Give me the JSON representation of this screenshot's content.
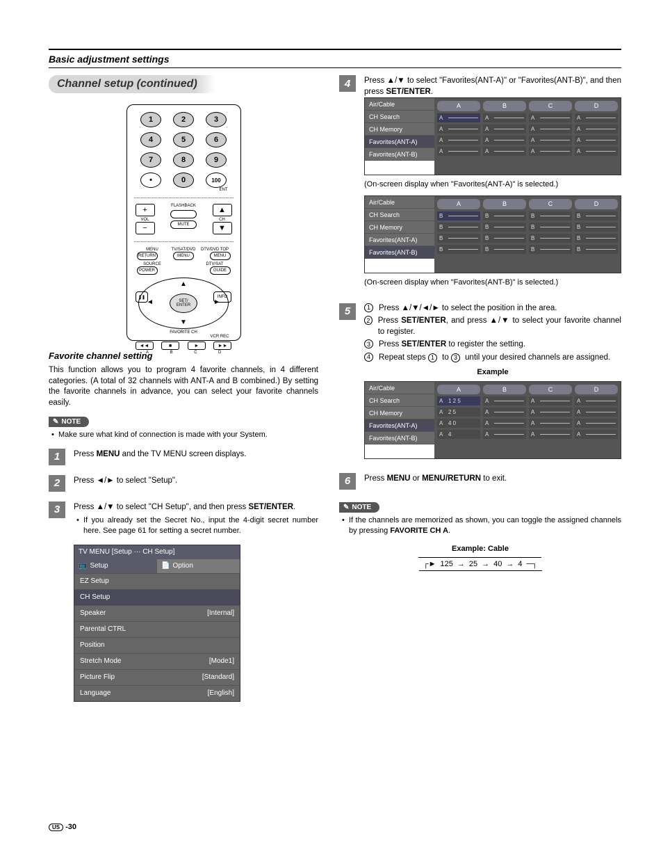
{
  "header": {
    "title": "Basic adjustment settings"
  },
  "section_title": "Channel setup (continued)",
  "remote": {
    "num": [
      "1",
      "2",
      "3",
      "4",
      "5",
      "6",
      "7",
      "8",
      "9",
      "•",
      "0",
      "100"
    ],
    "ent": "ENT",
    "flashback": "FLASHBACK",
    "vol": "VOL",
    "ch": "CH",
    "mute": "MUTE",
    "row_labels": [
      "MENU",
      "TV/SAT/DVD",
      "DTV/DVD TOP"
    ],
    "row_btns": [
      "RETURN",
      "MENU",
      "MENU"
    ],
    "row2_labels": [
      "SOURCE",
      "",
      "DTV/SAT"
    ],
    "row2_btns": [
      "POWER",
      "",
      "GUIDE"
    ],
    "setenter": "SET/\nENTER",
    "info": "INFO",
    "favorite": "FAVORITE CH",
    "vcr": "VCR REC",
    "media_labels": [
      "A",
      "B",
      "C",
      "D"
    ]
  },
  "favorite": {
    "heading": "Favorite channel setting",
    "body": "This function allows you to program 4 favorite channels, in 4 different categories. (A total of 32 channels with ANT-A and B combined.) By setting the favorite channels in advance, you can select your favorite channels easily.",
    "note_label": "NOTE",
    "note_bullet": "Make sure what kind of connection is made with your System."
  },
  "steps": {
    "s1": {
      "num": "1",
      "text_a": "Press ",
      "menu": "MENU",
      "text_b": " and the TV MENU screen displays."
    },
    "s2": {
      "num": "2",
      "text_a": "Press ",
      "arrows": "◄/►",
      "text_b": " to select \"Setup\"."
    },
    "s3": {
      "num": "3",
      "text_a": "Press ",
      "arrows": "▲/▼",
      "text_b": " to select \"CH Setup\", and then press ",
      "setenter": "SET/ENTER",
      "bullet": "If you already set the Secret No., input the 4-digit secret number here. See page 61 for setting a secret number."
    },
    "s4": {
      "num": "4",
      "text_a": "Press ",
      "arrows": "▲/▼",
      "text_b": " to select \"Favorites(ANT-A)\" or \"Favorites(ANT-B)\", and then press ",
      "setenter": "SET/ENTER"
    },
    "s5": {
      "num": "5",
      "sub1a": "Press ",
      "sub1_arrows": "▲/▼/◄/►",
      "sub1b": " to select the position in the area.",
      "sub2a": "Press ",
      "sub2_se": "SET/ENTER",
      "sub2b": ", and press ",
      "sub2_arrows": "▲/▼",
      "sub2c": " to select your favorite channel to register.",
      "sub3a": "Press ",
      "sub3_se": "SET/ENTER",
      "sub3b": " to register the setting.",
      "sub4a": "Repeat steps ",
      "sub4_1": "1",
      "sub4_to": " to ",
      "sub4_3": "3",
      "sub4b": " until your desired channels are assigned."
    },
    "s6": {
      "num": "6",
      "text_a": "Press ",
      "menu": "MENU",
      "or": " or ",
      "mr": "MENU/RETURN",
      "text_b": " to exit."
    }
  },
  "osd": {
    "breadcrumb": "TV MENU    [Setup ··· CH Setup]",
    "tab1": "Setup",
    "tab2": "Option",
    "rows": [
      {
        "l": "EZ Setup",
        "r": ""
      },
      {
        "l": "CH Setup",
        "r": ""
      },
      {
        "l": "Speaker",
        "r": "[Internal]"
      },
      {
        "l": "Parental CTRL",
        "r": ""
      },
      {
        "l": "Position",
        "r": ""
      },
      {
        "l": "Stretch Mode",
        "r": "[Mode1]"
      },
      {
        "l": "Picture Flip",
        "r": "[Standard]"
      },
      {
        "l": "Language",
        "r": "[English]"
      }
    ]
  },
  "fav_menu": {
    "left": [
      "Air/Cable",
      "CH Search",
      "CH Memory",
      "Favorites(ANT-A)",
      "Favorites(ANT-B)"
    ],
    "cols": [
      "A",
      "B",
      "C",
      "D"
    ]
  },
  "captions": {
    "antA": "(On-screen display when \"Favorites(ANT-A)\" is selected.)",
    "antB": "(On-screen display when \"Favorites(ANT-B)\" is selected.)"
  },
  "example_heading": "Example",
  "example_values": [
    [
      "A",
      "1 2 5"
    ],
    [
      "A",
      ""
    ],
    [
      "A",
      ""
    ],
    [
      "A",
      ""
    ],
    [
      "A",
      "2 5"
    ],
    [
      "A",
      ""
    ],
    [
      "A",
      ""
    ],
    [
      "A",
      ""
    ],
    [
      "A",
      "4 0"
    ],
    [
      "A",
      ""
    ],
    [
      "A",
      ""
    ],
    [
      "A",
      ""
    ],
    [
      "A",
      "4"
    ],
    [
      "A",
      ""
    ],
    [
      "A",
      ""
    ],
    [
      "A",
      ""
    ]
  ],
  "note2_bullet_a": "If the channels are memorized as shown, you can toggle the assigned channels by pressing ",
  "note2_b": "FAVORITE CH A",
  "example_cable_h": "Example: Cable",
  "loop": [
    "125",
    "25",
    "40",
    "4"
  ],
  "pagenum": "-30",
  "us": "US"
}
